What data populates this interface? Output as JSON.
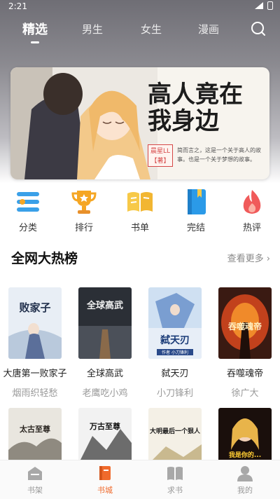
{
  "status_bar": {
    "time": "2:21"
  },
  "tabs": [
    {
      "label": "精选",
      "active": true
    },
    {
      "label": "男生"
    },
    {
      "label": "女生"
    },
    {
      "label": "漫画"
    }
  ],
  "banner": {
    "title": "高人竟在我身边",
    "author": "晨星LL\n【著】",
    "desc": "简而言之，这是一个关于高人的故事。也是一个关于梦想的故事。"
  },
  "categories": [
    {
      "label": "分类",
      "icon": "menu-list-icon",
      "color": "#3aa0e8"
    },
    {
      "label": "排行",
      "icon": "trophy-icon",
      "color": "#f5a623"
    },
    {
      "label": "书单",
      "icon": "open-book-icon",
      "color": "#f7c948"
    },
    {
      "label": "完结",
      "icon": "bookmark-book-icon",
      "color": "#2b9ae8"
    },
    {
      "label": "热评",
      "icon": "flame-icon",
      "color": "#f05a5a"
    }
  ],
  "section": {
    "title": "全网大热榜",
    "more": "查看更多"
  },
  "books_row1": [
    {
      "title": "大唐第一败家子",
      "author": "烟雨织轻愁"
    },
    {
      "title": "全球高武",
      "author": "老鹰吃小鸡"
    },
    {
      "title": "弑天刃",
      "author": "小刀锋利"
    },
    {
      "title": "吞噬魂帝",
      "author": "徐广大"
    }
  ],
  "books_row2": [
    {
      "cover_text": "太古至尊"
    },
    {
      "cover_text": "万古至尊"
    },
    {
      "cover_text": "大明最后一个狠人"
    },
    {
      "cover_text": "我是你的..."
    }
  ],
  "covers_text": {
    "c1": "败家子",
    "c2": "全球高武",
    "c3": "弑天刃",
    "c3_sub": "作者 小刀锋利",
    "c4": "吞噬魂帝"
  },
  "bottom_nav": [
    {
      "label": "书架",
      "active": false
    },
    {
      "label": "书城",
      "active": true
    },
    {
      "label": "求书",
      "active": false
    },
    {
      "label": "我的",
      "active": false
    }
  ],
  "colors": {
    "accent": "#f06a2c",
    "muted": "#999999"
  }
}
